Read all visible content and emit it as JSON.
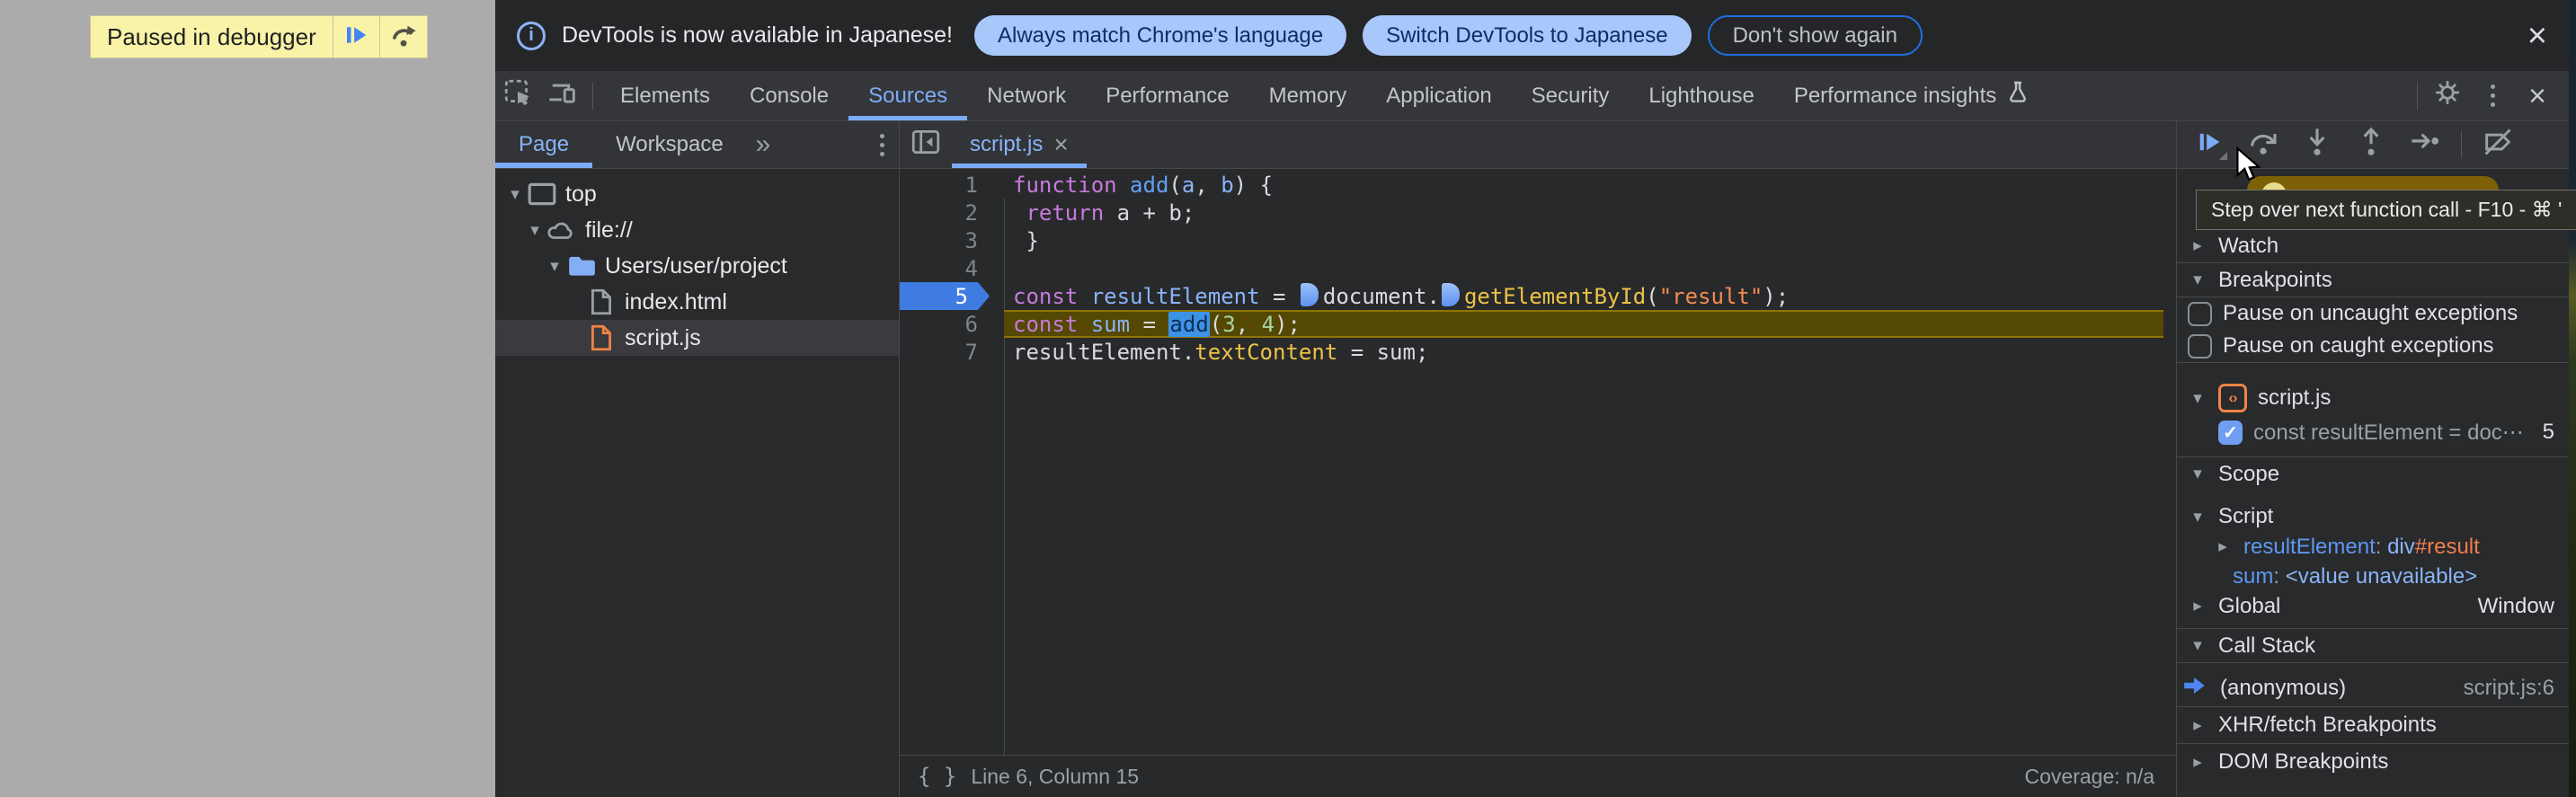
{
  "page": {
    "paused_badge": {
      "label": "Paused in debugger"
    }
  },
  "infobar": {
    "message": "DevTools is now available in Japanese!",
    "match_button": "Always match Chrome's language",
    "switch_button": "Switch DevTools to Japanese",
    "dismiss_button": "Don't show again"
  },
  "toolbar": {
    "tabs": [
      "Elements",
      "Console",
      "Sources",
      "Network",
      "Performance",
      "Memory",
      "Application",
      "Security",
      "Lighthouse",
      "Performance insights"
    ],
    "selected_tab": "Sources"
  },
  "icons": {
    "expand_down": "▾",
    "expand_right": "▸",
    "overflow_chevrons": "»",
    "close": "×",
    "pretty_print": "{ }",
    "code_tag": "‹›",
    "info": "i",
    "check": "✓"
  },
  "sources_panel": {
    "page_tab": "Page",
    "workspace_tab": "Workspace",
    "tree": [
      {
        "label": "top"
      },
      {
        "label": "file://"
      },
      {
        "label": "Users/user/project"
      },
      {
        "label": "index.html"
      },
      {
        "label": "script.js"
      }
    ]
  },
  "editor": {
    "tab_label": "script.js",
    "lines": [
      {
        "num": "1",
        "tokens": [
          [
            "kw",
            "function"
          ],
          [
            "pl",
            " "
          ],
          [
            "fn",
            "add"
          ],
          [
            "pl",
            "("
          ],
          [
            "vr",
            "a"
          ],
          [
            "pl",
            ", "
          ],
          [
            "vr",
            "b"
          ],
          [
            "pl",
            ") {"
          ]
        ]
      },
      {
        "num": "2",
        "tokens": [
          [
            "pl",
            " "
          ],
          [
            "kw",
            "return"
          ],
          [
            "pl",
            " a + b;"
          ]
        ]
      },
      {
        "num": "3",
        "tokens": [
          [
            "pl",
            " }"
          ]
        ]
      },
      {
        "num": "4",
        "tokens": []
      },
      {
        "num": "5",
        "paused": true,
        "tokens": [
          [
            "kw",
            "const"
          ],
          [
            "pl",
            " "
          ],
          [
            "vr",
            "resultElement"
          ],
          [
            "pl",
            " = "
          ],
          [
            "mk",
            ""
          ],
          [
            "pl",
            "document."
          ],
          [
            "mk",
            ""
          ],
          [
            "prop",
            "getElementById"
          ],
          [
            "pl",
            "("
          ],
          [
            "str",
            "\"result\""
          ],
          [
            "pl",
            ");"
          ]
        ]
      },
      {
        "num": "6",
        "highlight": true,
        "tokens": [
          [
            "kw",
            "const"
          ],
          [
            "pl",
            " "
          ],
          [
            "vr",
            "sum"
          ],
          [
            "pl",
            " = "
          ],
          [
            "sel",
            "add"
          ],
          [
            "pl",
            "("
          ],
          [
            "num",
            "3"
          ],
          [
            "pl",
            ", "
          ],
          [
            "num",
            "4"
          ],
          [
            "pl",
            ");"
          ]
        ]
      },
      {
        "num": "7",
        "tokens": [
          [
            "pl",
            "resultElement."
          ],
          [
            "prop",
            "textContent"
          ],
          [
            "pl",
            " = sum;"
          ]
        ]
      }
    ],
    "status": {
      "line_col": "Line 6, Column 15",
      "coverage": "Coverage: n/a"
    }
  },
  "debugger": {
    "tooltip": "Step over next function call - F10 - ⌘ '",
    "watch_label": "Watch",
    "breakpoints_label": "Breakpoints",
    "pause_uncaught": "Pause on uncaught exceptions",
    "pause_caught": "Pause on caught exceptions",
    "breakpoint_group": {
      "file": "script.js",
      "entry_text": "const resultElement = doc⋯",
      "entry_line": "5"
    },
    "scope_label": "Scope",
    "scope": {
      "script_label": "Script",
      "result_name": "resultElement",
      "result_sep": ": ",
      "result_tag": "div",
      "result_id": "#result",
      "sum_name": "sum",
      "sum_sep": ": ",
      "sum_value": "<value unavailable>",
      "global_label": "Global",
      "global_value": "Window"
    },
    "callstack_label": "Call Stack",
    "callstack": {
      "frame": "(anonymous)",
      "location": "script.js:6"
    },
    "xhr_label": "XHR/fetch Breakpoints",
    "dom_label": "DOM Breakpoints"
  }
}
